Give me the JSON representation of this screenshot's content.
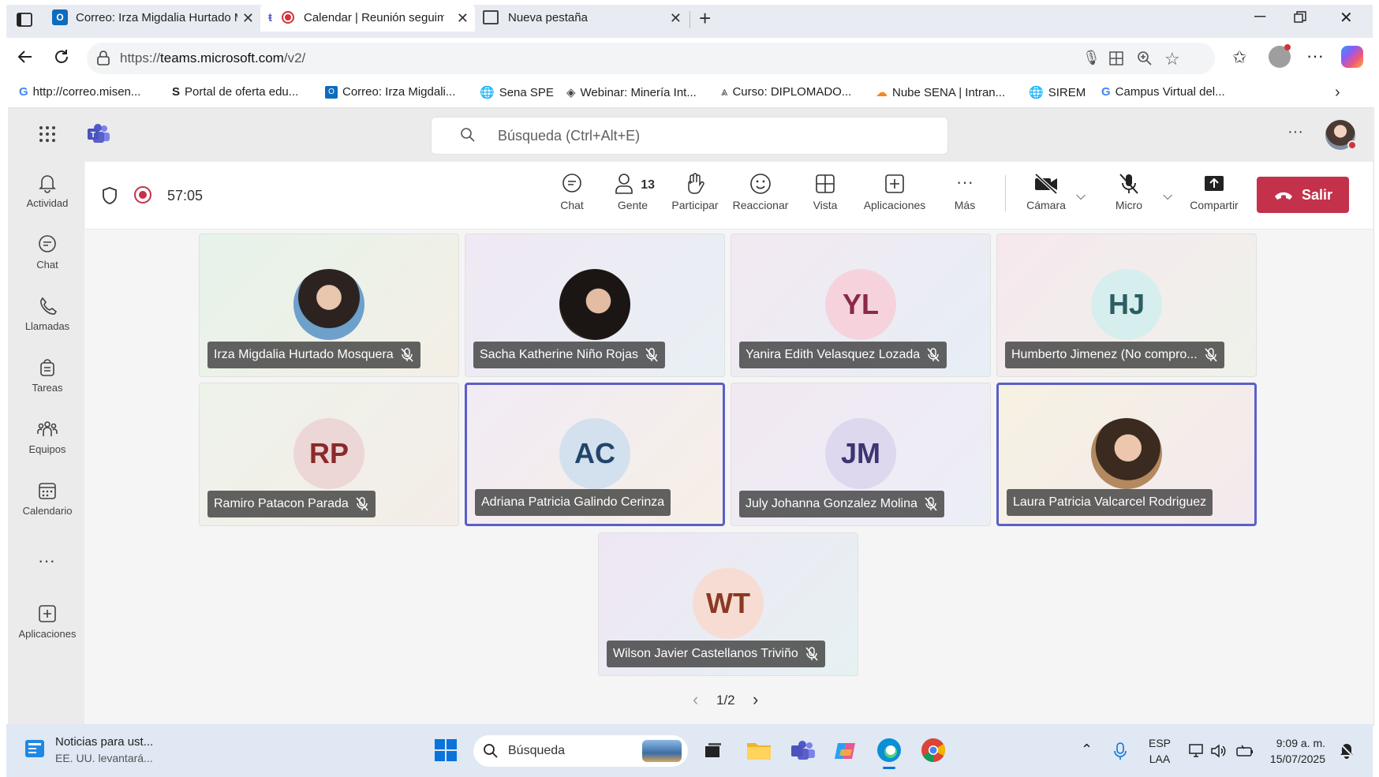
{
  "browser": {
    "tabs": [
      {
        "title": "Correo: Irza Migdalia Hurtado Mo"
      },
      {
        "title": "Calendar | Reunión seguimie"
      },
      {
        "title": "Nueva pestaña"
      }
    ],
    "url_prefix": "https://",
    "url_host": "teams.microsoft.com",
    "url_path": "/v2/",
    "bookmarks": [
      {
        "label": "http://correo.misen..."
      },
      {
        "label": "Portal de oferta edu..."
      },
      {
        "label": "Correo: Irza Migdali..."
      },
      {
        "label": "Sena SPE"
      },
      {
        "label": "Webinar: Minería Int..."
      },
      {
        "label": "Curso: DIPLOMADO..."
      },
      {
        "label": "Nube SENA | Intran..."
      },
      {
        "label": "SIREM"
      },
      {
        "label": "Campus Virtual del..."
      }
    ]
  },
  "teams": {
    "search_placeholder": "Búsqueda (Ctrl+Alt+E)",
    "rail": [
      {
        "label": "Actividad",
        "icon": "bell-icon"
      },
      {
        "label": "Chat",
        "icon": "chat-icon"
      },
      {
        "label": "Llamadas",
        "icon": "phone-icon"
      },
      {
        "label": "Tareas",
        "icon": "tasks-icon"
      },
      {
        "label": "Equipos",
        "icon": "teams-icon"
      },
      {
        "label": "Calendario",
        "icon": "calendar-icon"
      },
      {
        "label": "Aplicaciones",
        "icon": "apps-icon"
      }
    ],
    "meeting": {
      "timer": "57:05",
      "controls": {
        "chat": "Chat",
        "people": "Gente",
        "people_count": "13",
        "raise": "Participar",
        "react": "Reaccionar",
        "view": "Vista",
        "apps": "Aplicaciones",
        "more": "Más",
        "camera": "Cámara",
        "mic": "Micro",
        "share": "Compartir",
        "leave": "Salir"
      },
      "participants": [
        {
          "name": "Irza Migdalia Hurtado Mosquera",
          "initials": "",
          "photo": true,
          "muted": true
        },
        {
          "name": "Sacha Katherine Niño Rojas",
          "initials": "",
          "photo": true,
          "muted": true
        },
        {
          "name": "Yanira Edith Velasquez Lozada",
          "initials": "YL",
          "photo": false,
          "muted": true
        },
        {
          "name": "Humberto Jimenez (No compro...",
          "initials": "HJ",
          "photo": false,
          "muted": true
        },
        {
          "name": "Ramiro Patacon Parada",
          "initials": "RP",
          "photo": false,
          "muted": true
        },
        {
          "name": "Adriana Patricia Galindo Cerinza",
          "initials": "AC",
          "photo": false,
          "muted": false
        },
        {
          "name": "July Johanna Gonzalez Molina",
          "initials": "JM",
          "photo": false,
          "muted": true
        },
        {
          "name": "Laura Patricia Valcarcel Rodriguez",
          "initials": "",
          "photo": true,
          "muted": false
        },
        {
          "name": "Wilson Javier Castellanos Triviño",
          "initials": "WT",
          "photo": false,
          "muted": true
        }
      ],
      "pager": "1/2"
    }
  },
  "taskbar": {
    "news_title": "Noticias para ust...",
    "news_sub": "EE. UU. levantará...",
    "search_label": "Búsqueda",
    "lang_1": "ESP",
    "lang_2": "LAA",
    "time": "9:09 a. m.",
    "date": "15/07/2025"
  }
}
